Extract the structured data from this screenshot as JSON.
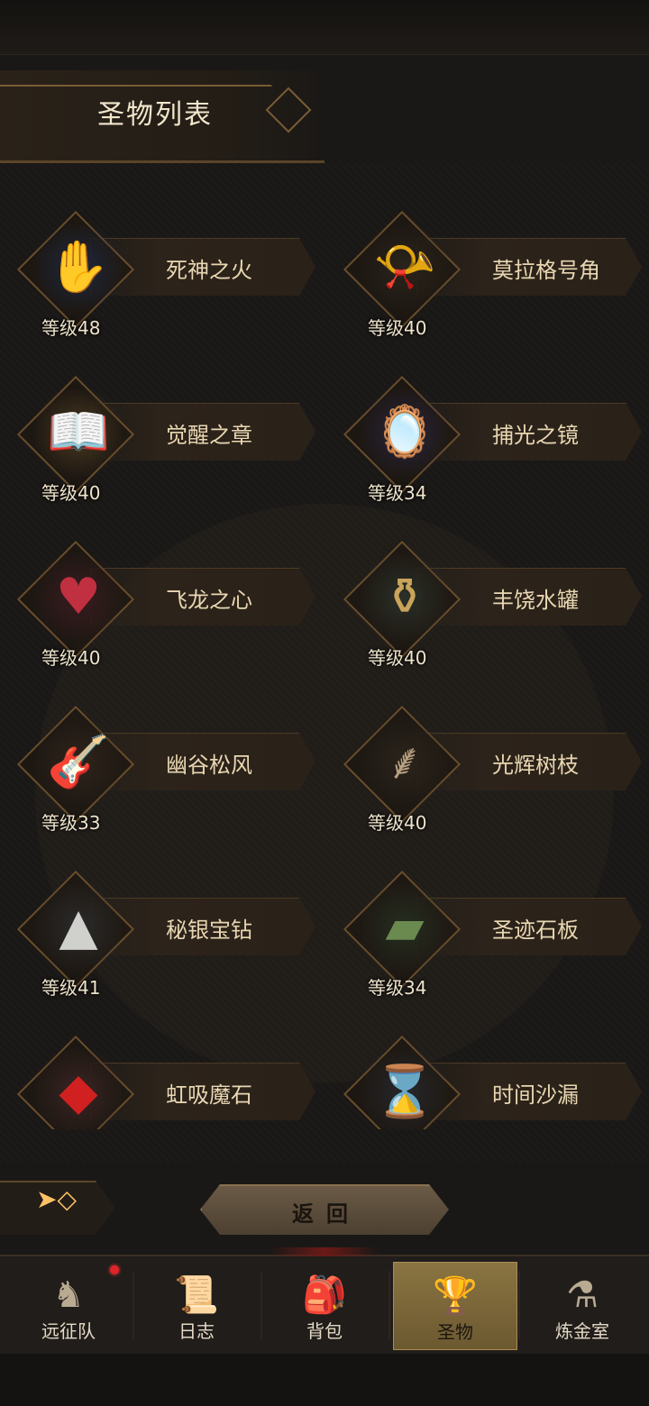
{
  "header": {
    "title": "圣物列表"
  },
  "relics": [
    {
      "name": "死神之火",
      "level": "等级48",
      "icon": "ghost-hand-icon",
      "glyph": "✋",
      "color": "#7aa6e8",
      "bg": "#1e2840"
    },
    {
      "name": "莫拉格号角",
      "level": "等级40",
      "icon": "horn-icon",
      "glyph": "📯",
      "color": "#c7b08a",
      "bg": "#2b241c"
    },
    {
      "name": "觉醒之章",
      "level": "等级40",
      "icon": "tome-icon",
      "glyph": "📖",
      "color": "#c9a04c",
      "bg": "#4a3a20"
    },
    {
      "name": "捕光之镜",
      "level": "等级34",
      "icon": "mirror-icon",
      "glyph": "🪞",
      "color": "#8a7ad0",
      "bg": "#2a2440"
    },
    {
      "name": "飞龙之心",
      "level": "等级40",
      "icon": "dragon-heart-icon",
      "glyph": "♥",
      "color": "#c03040",
      "bg": "#3a1c20"
    },
    {
      "name": "丰饶水罐",
      "level": "等级40",
      "icon": "urn-icon",
      "glyph": "⚱",
      "color": "#c9a45a",
      "bg": "#2a3028"
    },
    {
      "name": "幽谷松风",
      "level": "等级33",
      "icon": "lute-icon",
      "glyph": "🎸",
      "color": "#a4784a",
      "bg": "#2e241b"
    },
    {
      "name": "光辉树枝",
      "level": "等级40",
      "icon": "branch-icon",
      "glyph": "⸙",
      "color": "#b8a080",
      "bg": "#2a241c"
    },
    {
      "name": "秘银宝钻",
      "level": "等级41",
      "icon": "pyramid-gem-icon",
      "glyph": "▲",
      "color": "#d0d0cc",
      "bg": "#2b2b2b"
    },
    {
      "name": "圣迹石板",
      "level": "等级34",
      "icon": "stone-tablet-icon",
      "glyph": "▰",
      "color": "#6a8a50",
      "bg": "#252e20"
    },
    {
      "name": "虹吸魔石",
      "level": "",
      "icon": "red-stone-icon",
      "glyph": "◆",
      "color": "#d02020",
      "bg": "#3a2424"
    },
    {
      "name": "时间沙漏",
      "level": "",
      "icon": "hourglass-icon",
      "glyph": "⌛",
      "color": "#a8b8c8",
      "bg": "#26282c"
    }
  ],
  "controls": {
    "back_label": "返回",
    "toggle_icon": "arrow-diamond-icon"
  },
  "nav": {
    "tabs": [
      {
        "label": "远征队",
        "icon": "helmet-icon",
        "glyph": "♞",
        "active": false,
        "notify": true
      },
      {
        "label": "日志",
        "icon": "scroll-icon",
        "glyph": "📜",
        "active": false,
        "notify": false
      },
      {
        "label": "背包",
        "icon": "bag-icon",
        "glyph": "🎒",
        "active": false,
        "notify": false
      },
      {
        "label": "圣物",
        "icon": "torch-icon",
        "glyph": "🏆",
        "active": true,
        "notify": false
      },
      {
        "label": "炼金室",
        "icon": "alchemy-icon",
        "glyph": "⚗",
        "active": false,
        "notify": false
      }
    ]
  }
}
